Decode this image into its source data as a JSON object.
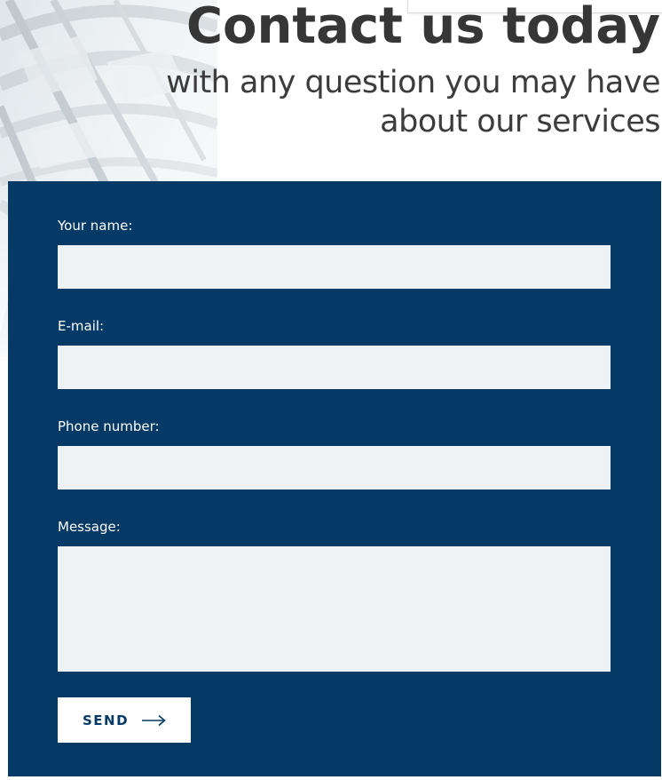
{
  "header": {
    "title": "Contact us today",
    "subtitle": "with any question you may have about our services"
  },
  "form": {
    "fields": [
      {
        "label": "Your name:",
        "value": "",
        "placeholder": ""
      },
      {
        "label": "E-mail:",
        "value": "",
        "placeholder": ""
      },
      {
        "label": "Phone number:",
        "value": "",
        "placeholder": ""
      },
      {
        "label": "Message:",
        "value": "",
        "placeholder": ""
      }
    ],
    "submit_label": "SEND",
    "submit_icon": "arrow-right-icon"
  },
  "colors": {
    "panel_background": "#053a66",
    "input_background": "#eff2f5",
    "title_text": "#363636",
    "button_background": "#ffffff",
    "button_text": "#053a66"
  }
}
